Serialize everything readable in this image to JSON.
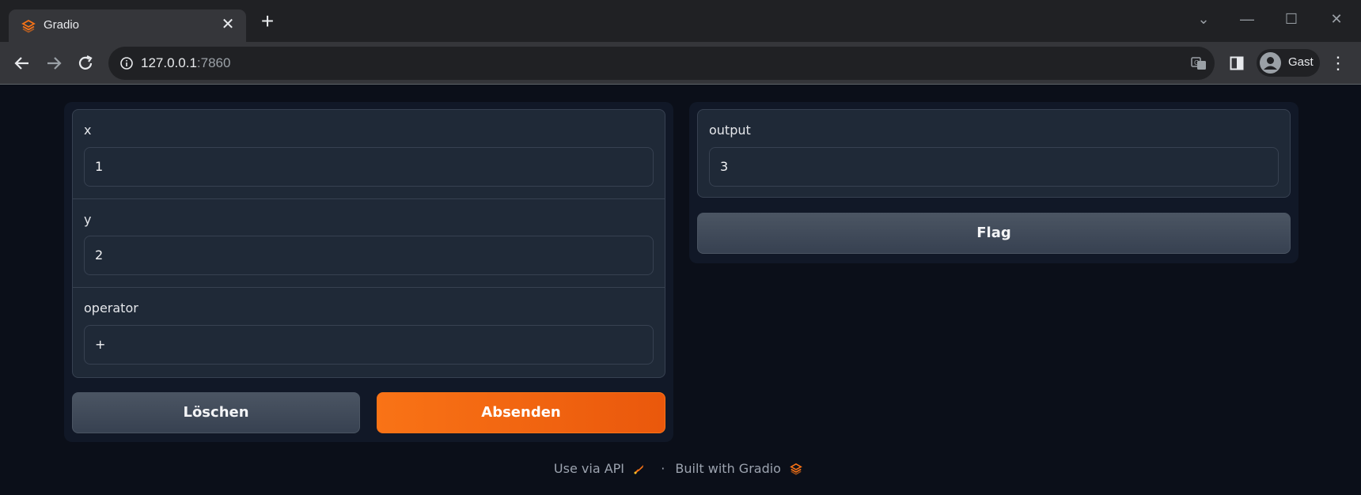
{
  "browser": {
    "tab_title": "Gradio",
    "url_host": "127.0.0.1",
    "url_port": ":7860",
    "profile_name": "Gast"
  },
  "inputs": [
    {
      "label": "x",
      "value": "1"
    },
    {
      "label": "y",
      "value": "2"
    },
    {
      "label": "operator",
      "value": "+"
    }
  ],
  "output": {
    "label": "output",
    "value": "3"
  },
  "buttons": {
    "clear": "Löschen",
    "submit": "Absenden",
    "flag": "Flag"
  },
  "footer": {
    "api_text": "Use via API",
    "separator": "·",
    "built_text": "Built with Gradio"
  },
  "colors": {
    "accent": "#f97316",
    "background": "#0b0f19",
    "panel": "#111827",
    "block": "#1f2937"
  }
}
